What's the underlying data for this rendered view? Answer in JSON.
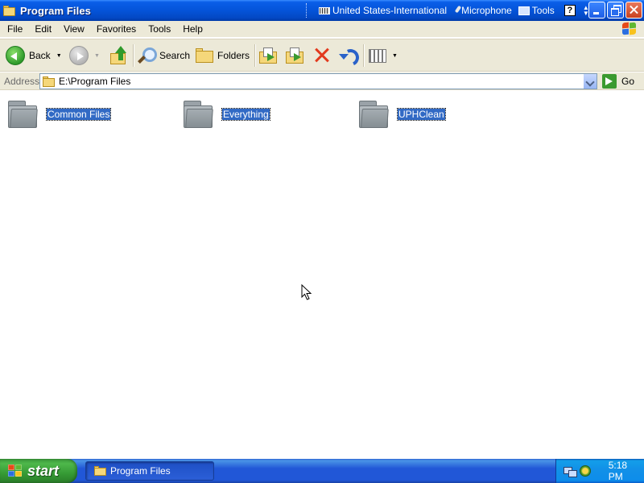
{
  "window": {
    "title": "Program Files"
  },
  "language_bar": {
    "language": "United States-International",
    "microphone": "Microphone",
    "tools": "Tools",
    "help": "?"
  },
  "menu": {
    "items": [
      "File",
      "Edit",
      "View",
      "Favorites",
      "Tools",
      "Help"
    ]
  },
  "toolbar": {
    "back_label": "Back",
    "search_label": "Search",
    "folders_label": "Folders"
  },
  "address": {
    "label": "Address",
    "value": "E:\\Program Files",
    "go_label": "Go"
  },
  "files": [
    {
      "name": "Common Files",
      "icon": "folder-icon"
    },
    {
      "name": "Everything",
      "icon": "folder-icon"
    },
    {
      "name": "UPHClean",
      "icon": "folder-icon"
    }
  ],
  "taskbar": {
    "start_label": "start",
    "task_label": "Program Files",
    "clock": "5:18 PM"
  },
  "colors": {
    "titlebar": "#0454d9",
    "selection": "#316ac5",
    "taskbar": "#2157d7",
    "start": "#3c9a3b"
  }
}
